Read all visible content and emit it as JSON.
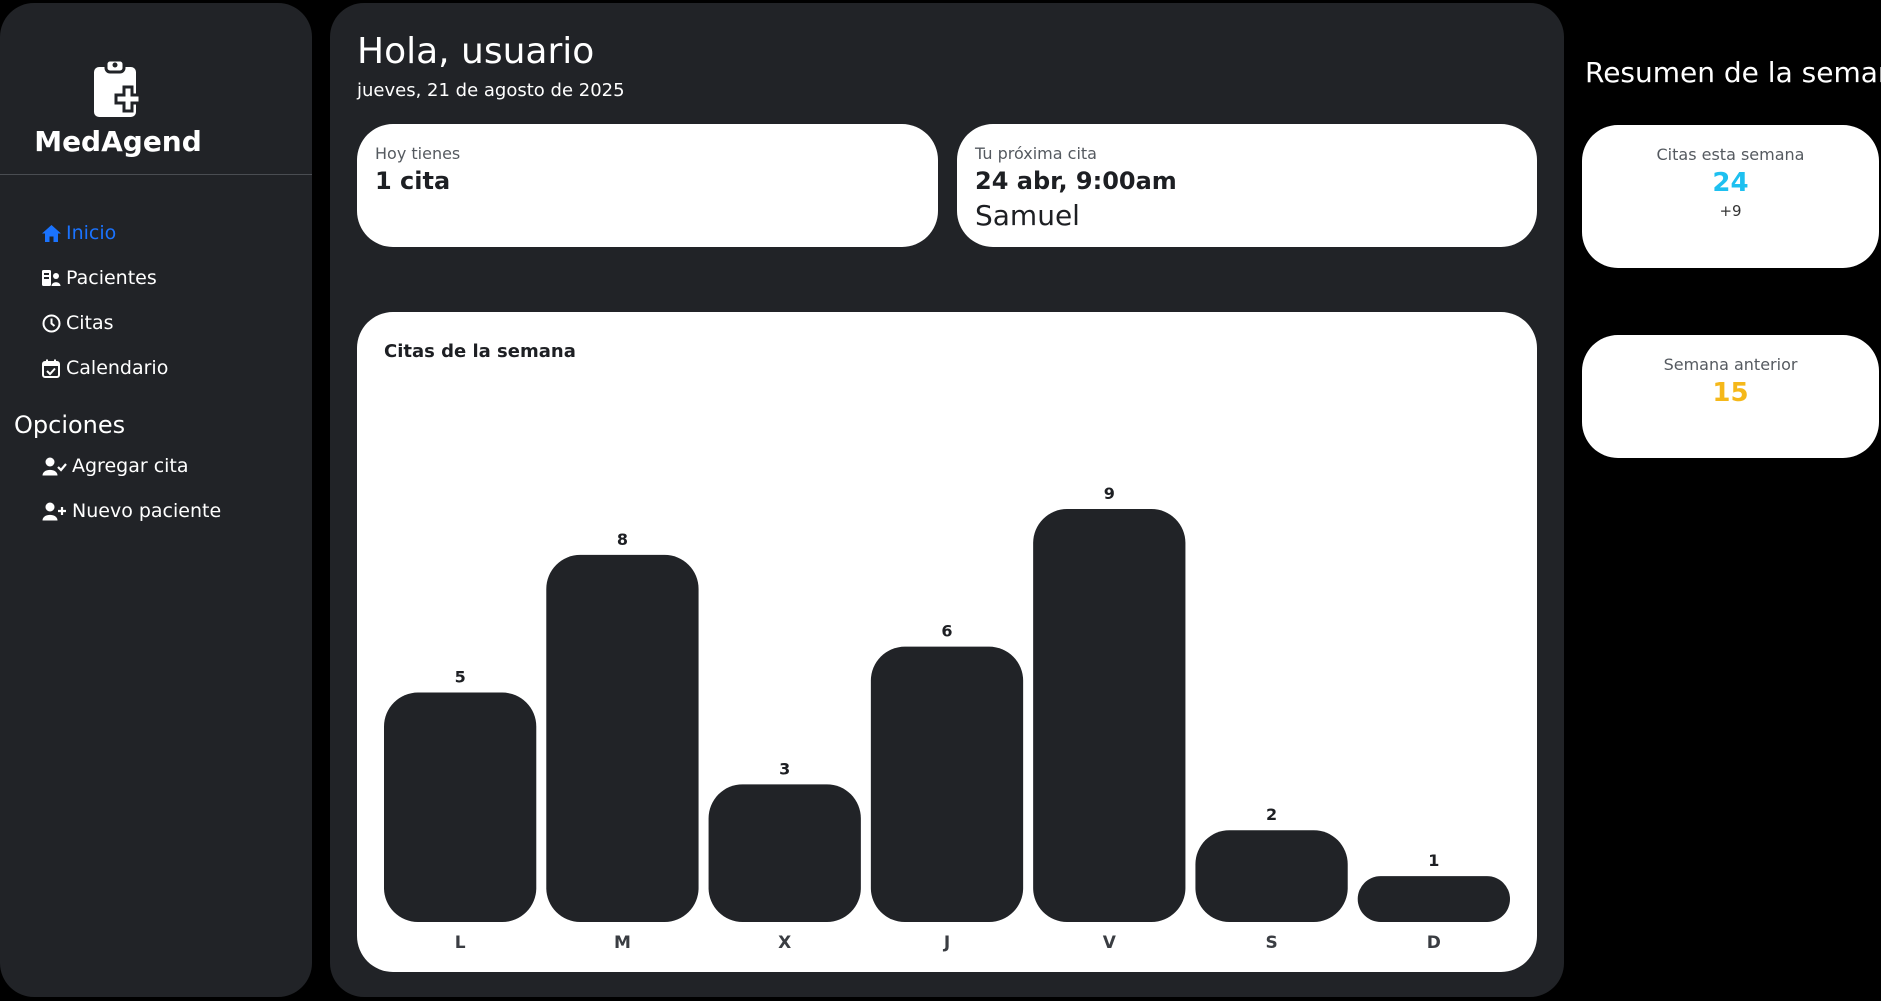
{
  "app": {
    "name": "MedAgend"
  },
  "sidebar": {
    "items": [
      {
        "label": "Inicio",
        "icon": "home-icon",
        "active": true
      },
      {
        "label": "Pacientes",
        "icon": "patient-id-icon",
        "active": false
      },
      {
        "label": "Citas",
        "icon": "clock-icon",
        "active": false
      },
      {
        "label": "Calendario",
        "icon": "calendar-check-icon",
        "active": false
      }
    ],
    "options_title": "Opciones",
    "options": [
      {
        "label": "Agregar cita",
        "icon": "user-check-icon"
      },
      {
        "label": "Nuevo paciente",
        "icon": "user-plus-icon"
      }
    ]
  },
  "header": {
    "greeting": "Hola, usuario",
    "date": "jueves, 21 de agosto de 2025"
  },
  "today_card": {
    "label": "Hoy tienes",
    "value": "1 cita"
  },
  "next_card": {
    "label": "Tu próxima cita",
    "value": "24 abr, 9:00am",
    "patient": "Samuel"
  },
  "chart_data": {
    "type": "bar",
    "title": "Citas de la semana",
    "categories": [
      "L",
      "M",
      "X",
      "J",
      "V",
      "S",
      "D"
    ],
    "values": [
      5,
      8,
      3,
      6,
      9,
      2,
      1
    ],
    "xlabel": "",
    "ylabel": "",
    "ylim": [
      0,
      9
    ],
    "grid": false,
    "bar_color": "#212327"
  },
  "summary": {
    "title": "Resumen de la semana",
    "week": {
      "label": "Citas esta semana",
      "value": "24",
      "delta": "+9",
      "color": "#1ec0f0"
    },
    "previous": {
      "label": "Semana anterior",
      "value": "15",
      "color": "#f5b81a"
    }
  },
  "colors": {
    "background": "#000000",
    "panel": "#212327",
    "accent": "#1a73ff",
    "card": "#ffffff"
  }
}
